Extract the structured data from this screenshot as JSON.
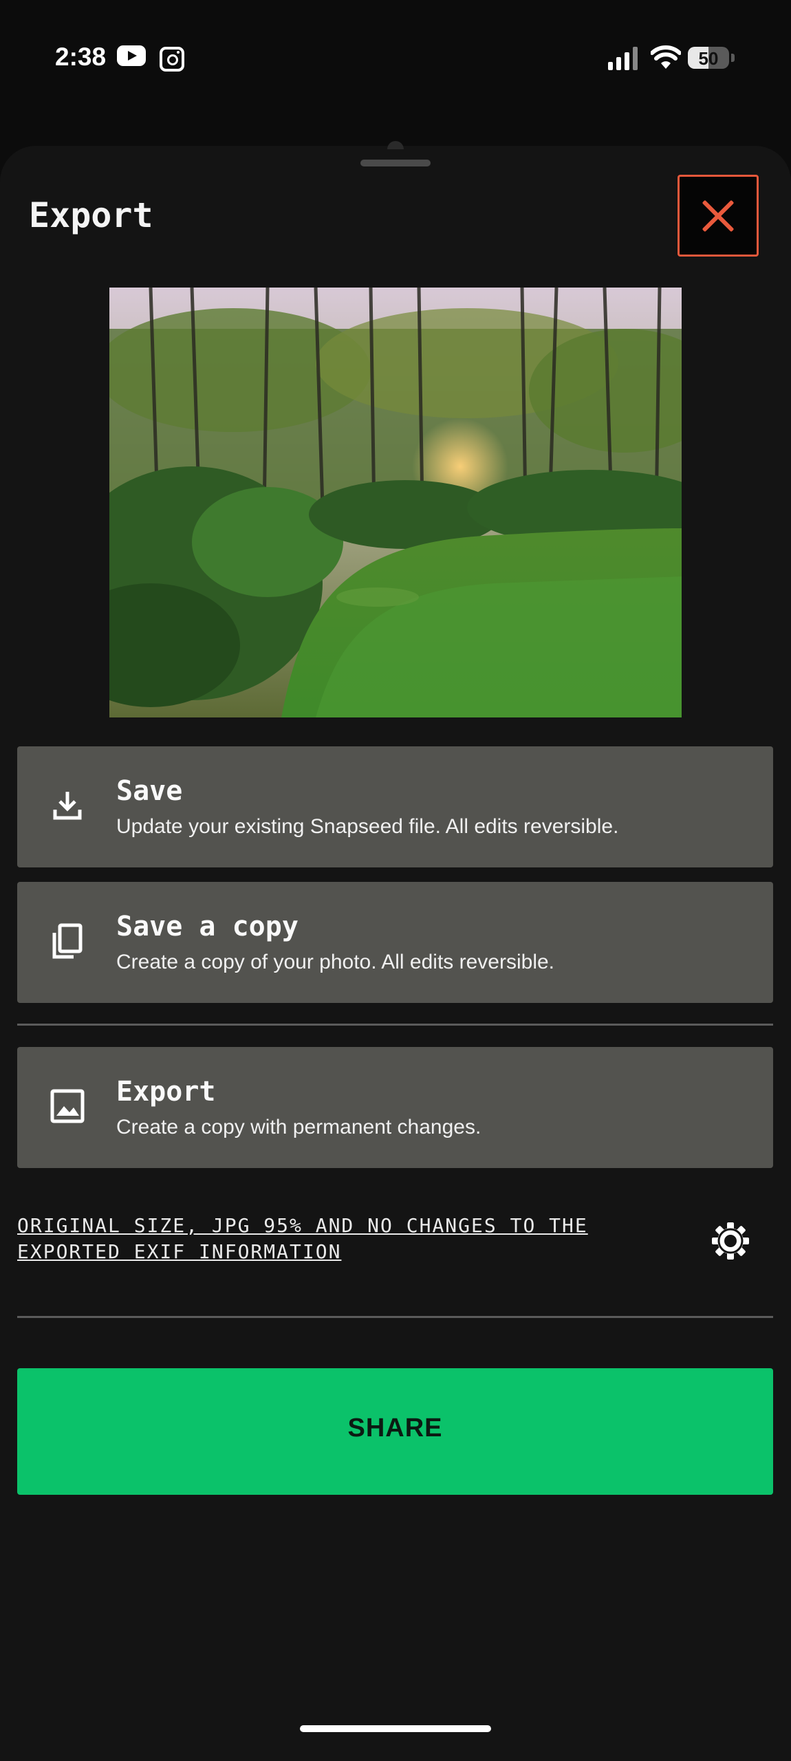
{
  "status_bar": {
    "time": "2:38",
    "battery": "50",
    "icons": [
      "youtube-icon",
      "instagram-icon",
      "signal-icon",
      "wifi-icon",
      "battery-icon"
    ]
  },
  "sheet": {
    "title": "Export",
    "close_icon": "close-icon",
    "accent_color": "#ea5a3c"
  },
  "options": [
    {
      "title": "Save",
      "subtitle": "Update your existing Snapseed file. All edits reversible.",
      "icon": "download-icon"
    },
    {
      "title": "Save a copy",
      "subtitle": "Create a copy of your photo. All edits reversible.",
      "icon": "copy-icon"
    },
    {
      "title": "Export",
      "subtitle": "Create a copy with permanent changes.",
      "icon": "image-icon"
    }
  ],
  "export_settings": {
    "line1": "ORIGINAL SIZE, JPG 95% AND NO CHANGES TO THE",
    "line2": "EXPORTED EXIF INFORMATION",
    "icon": "gear-icon"
  },
  "share": {
    "label": "SHARE",
    "color": "#0bc26a"
  }
}
